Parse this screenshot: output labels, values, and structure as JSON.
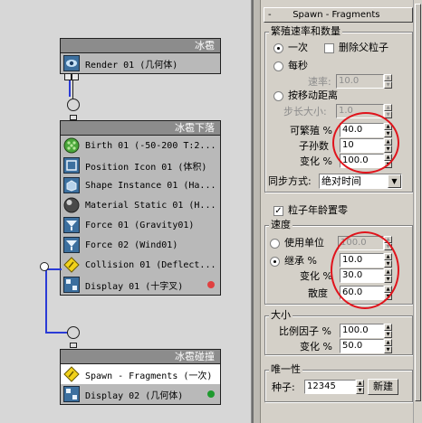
{
  "graph": {
    "node1": {
      "title": "冰雹",
      "operators": [
        {
          "text": "Render 01 (几何体)",
          "icon": "render-icon"
        }
      ]
    },
    "node2": {
      "title": "冰雹下落",
      "operators": [
        {
          "text": "Birth 01 (-50-200 T:2...",
          "icon": "birth-icon"
        },
        {
          "text": "Position Icon 01 (体积)",
          "icon": "position-icon"
        },
        {
          "text": "Shape Instance 01 (Ha...",
          "icon": "shape-instance-icon"
        },
        {
          "text": "Material Static 01 (H...",
          "icon": "material-icon"
        },
        {
          "text": "Force 01 (Gravity01)",
          "icon": "force-icon"
        },
        {
          "text": "Force 02 (Wind01)",
          "icon": "force-icon"
        },
        {
          "text": "Collision 01 (Deflect...",
          "icon": "collision-test-icon"
        },
        {
          "text": "Display 01 (十字叉)",
          "icon": "display-icon",
          "dot_color": "#e04040"
        }
      ]
    },
    "node3": {
      "title": "冰雹碰撞",
      "operators": [
        {
          "text": "Spawn - Fragments (一次)",
          "icon": "spawn-test-icon",
          "selected": true
        },
        {
          "text": "Display 02 (几何体)",
          "icon": "display-icon",
          "dot_color": "#1e9a2e"
        }
      ]
    }
  },
  "panel": {
    "rollout_sign": "-",
    "rollout_title": "Spawn - Fragments",
    "spawn_rate": {
      "label": "繁殖速率和数量",
      "once": "一次",
      "delete_parent": "删除父粒子",
      "delete_parent_checked": false,
      "per_second": "每秒",
      "rate_label": "速率:",
      "rate_value": "10.0",
      "by_distance": "按移动距离",
      "step_label": "步长大小:",
      "step_value": "1.0",
      "spawnable_label": "可繁殖 %",
      "spawnable_value": "40.0",
      "offspring_label": "子孙数",
      "offspring_value": "10",
      "variation_label": "变化 %",
      "variation_value": "100.0",
      "sync_label": "同步方式:",
      "sync_value": "绝对时间"
    },
    "age_reset": {
      "label": "粒子年龄置零",
      "checked": true
    },
    "speed": {
      "label": "速度",
      "use_units": "使用单位",
      "use_units_value": "100.0",
      "inherit": "继承 %",
      "inherit_value": "10.0",
      "variation_label": "变化 %",
      "variation_value": "30.0",
      "divergence_label": "散度",
      "divergence_value": "60.0"
    },
    "size": {
      "label": "大小",
      "scale_label": "比例因子 %",
      "scale_value": "100.0",
      "variation_label": "变化 %",
      "variation_value": "50.0"
    },
    "uniqueness": {
      "label": "唯一性",
      "seed_label": "种子:",
      "seed_value": "12345",
      "new_button": "新建"
    }
  },
  "colors": {
    "highlight_ellipse": "#e0141c",
    "wire": "#2a3bd6",
    "node_title_bg": "#8c8c8c"
  }
}
